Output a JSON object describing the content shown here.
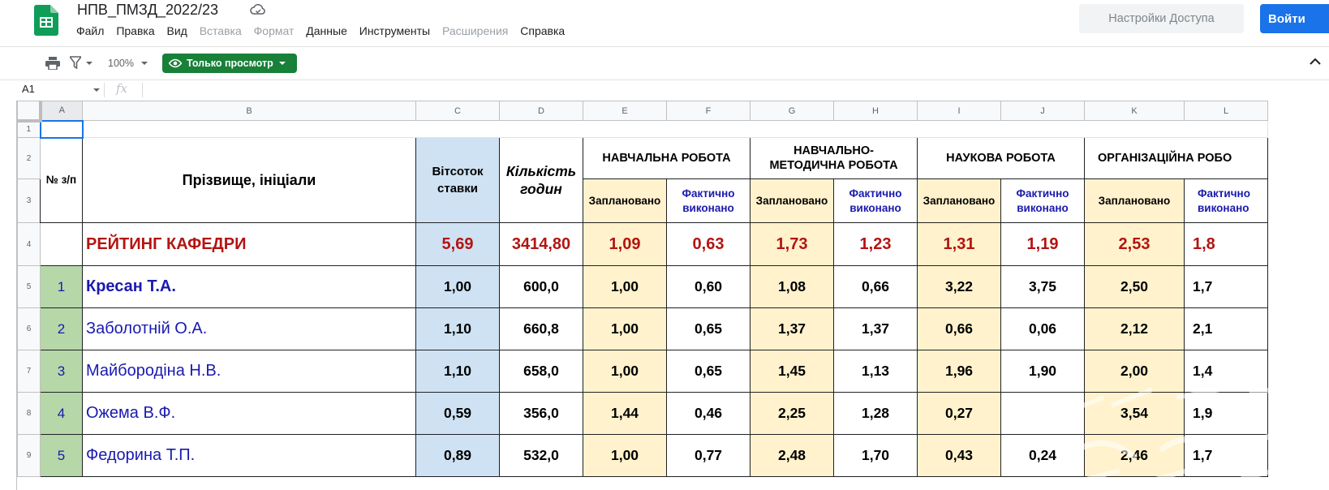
{
  "header": {
    "doc_title": "НПВ_ПМЗД_2022/23",
    "menu": [
      "Файл",
      "Правка",
      "Вид",
      "Вставка",
      "Формат",
      "Данные",
      "Инструменты",
      "Расширения",
      "Справка"
    ],
    "menu_disabled": [
      "Вставка",
      "Формат",
      "Расширения"
    ],
    "share_label": "Настройки Доступа",
    "login_label": "Войти"
  },
  "toolbar": {
    "zoom": "100%",
    "view_only_label": "Только просмотр"
  },
  "formula_bar": {
    "name_box": "A1",
    "fx": "fx"
  },
  "grid": {
    "columns": [
      "A",
      "B",
      "C",
      "D",
      "E",
      "F",
      "G",
      "H",
      "I",
      "J",
      "K",
      "L"
    ],
    "row_numbers": [
      "1",
      "2",
      "3",
      "4",
      "5",
      "6",
      "7",
      "8",
      "9"
    ],
    "headers": {
      "num": "№ з/п",
      "name": "Прізвище, ініціали",
      "pct": "Вітсоток ставки",
      "hours": "Кількість годин",
      "sections": [
        "НАВЧАЛЬНА РОБОТА",
        "НАВЧАЛЬНО-МЕТОДИЧНА РОБОТА",
        "НАУКОВА РОБОТА",
        "ОРГАНІЗАЦІЙНА РОБО"
      ],
      "planned": "Заплановано",
      "actual": "Фактично виконано"
    },
    "rating": {
      "label": "РЕЙТИНГ КАФЕДРИ",
      "pct": "5,69",
      "hours": "3414,80",
      "values": [
        "1,09",
        "0,63",
        "1,73",
        "1,23",
        "1,31",
        "1,19",
        "2,53",
        "1,8"
      ]
    },
    "rows": [
      {
        "num": "1",
        "name": "Кресан Т.А.",
        "pct": "1,00",
        "hours": "600,0",
        "values": [
          "1,00",
          "0,60",
          "1,08",
          "0,66",
          "3,22",
          "3,75",
          "2,50",
          "1,7"
        ]
      },
      {
        "num": "2",
        "name": "Заболотній О.А.",
        "pct": "1,10",
        "hours": "660,8",
        "values": [
          "1,00",
          "0,65",
          "1,37",
          "1,37",
          "0,66",
          "0,06",
          "2,12",
          "2,1"
        ]
      },
      {
        "num": "3",
        "name": "Майбородіна Н.В.",
        "pct": "1,10",
        "hours": "658,0",
        "values": [
          "1,00",
          "0,65",
          "1,45",
          "1,13",
          "1,96",
          "1,90",
          "2,00",
          "1,4"
        ]
      },
      {
        "num": "4",
        "name": "Ожема В.Ф.",
        "pct": "0,59",
        "hours": "356,0",
        "values": [
          "1,44",
          "0,46",
          "2,25",
          "1,28",
          "0,27",
          "",
          "3,54",
          "1,9"
        ]
      },
      {
        "num": "5",
        "name": "Федорина Т.П.",
        "pct": "0,89",
        "hours": "532,0",
        "values": [
          "1,00",
          "0,77",
          "2,48",
          "1,70",
          "0,43",
          "0,24",
          "2,46",
          "1,7"
        ]
      }
    ]
  },
  "icons": {
    "logo": "google-sheets-logo",
    "cloud": "cloud-status-icon",
    "print": "print-icon",
    "filter": "filter-icon",
    "eye": "eye-icon",
    "collapse": "chevron-up-icon"
  },
  "colors": {
    "accent_blue": "#1a73e8",
    "view_only_green": "#188038",
    "rating_red": "#b31412",
    "name_blue": "#1a1ab0",
    "pct_fill": "#cfe2f3",
    "planned_fill": "#fff2cc",
    "num_fill": "#b6d7a8"
  }
}
